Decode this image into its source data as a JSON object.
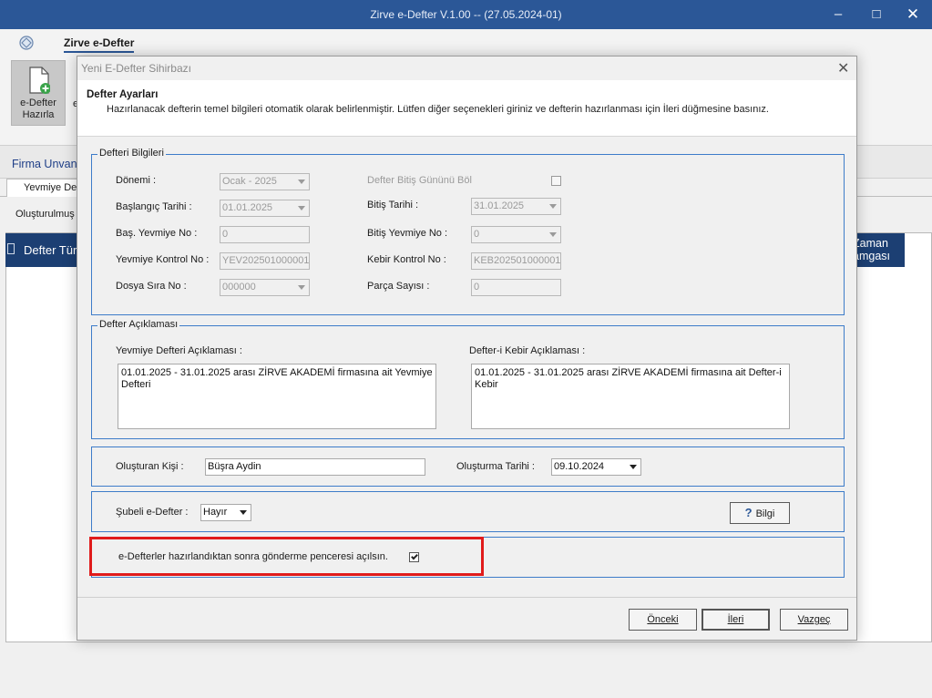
{
  "window": {
    "title": "Zirve e-Defter V.1.00  -- (27.05.2024-01)"
  },
  "ribbon": {
    "tab": "Zirve e-Defter",
    "prepare_button": "e-Defter Hazırla",
    "peek_text": "e",
    "icons": {
      "app": "app-orb-icon",
      "new_doc": "new-document-icon"
    }
  },
  "background": {
    "firma_label": "Firma Unvan",
    "tab_label": "Yevmiye Def",
    "olusturulmus": "Oluşturulmuş E",
    "grid": {
      "col1": "Defter Tür",
      "col2_line1": "Zaman",
      "col2_line2": "amgası"
    }
  },
  "dialog": {
    "title": "Yeni E-Defter Sihirbazı",
    "header_title": "Defter Ayarları",
    "header_desc": "Hazırlanacak defterin temel bilgileri otomatik olarak belirlenmiştir. Lütfen diğer seçenekleri giriniz ve defterin hazırlanması için İleri düğmesine basınız.",
    "bilgileri": {
      "legend": "Defteri Bilgileri",
      "donemi_label": "Dönemi :",
      "donemi_value": "Ocak - 2025",
      "bitis_gunu_label": "Defter Bitiş Gününü Böl",
      "baslangic_label": "Başlangıç Tarihi :",
      "baslangic_value": "01.01.2025",
      "bitis_label": "Bitiş Tarihi :",
      "bitis_value": "31.01.2025",
      "bas_yevmiye_label": "Baş. Yevmiye No :",
      "bas_yevmiye_value": "0",
      "bitis_yevmiye_label": "Bitiş Yevmiye No :",
      "bitis_yevmiye_value": "0",
      "yevmiye_kontrol_label": "Yevmiye Kontrol No :",
      "yevmiye_kontrol_value": "YEV202501000001",
      "kebir_kontrol_label": "Kebir Kontrol No :",
      "kebir_kontrol_value": "KEB202501000001",
      "dosya_sira_label": "Dosya Sıra No :",
      "dosya_sira_value": "000000",
      "parca_label": "Parça Sayısı :",
      "parca_value": "0"
    },
    "aciklama": {
      "legend": "Defter Açıklaması",
      "yevmiye_label": "Yevmiye Defteri Açıklaması :",
      "yevmiye_value": "01.01.2025 - 31.01.2025 arası ZİRVE AKADEMİ firmasına ait Yevmiye Defteri",
      "kebir_label": "Defter-i Kebir Açıklaması :",
      "kebir_value": "01.01.2025 - 31.01.2025 arası ZİRVE AKADEMİ firmasına ait Defter-i Kebir"
    },
    "olusturan": {
      "kisi_label": "Oluşturan Kişi :",
      "kisi_value": "Büşra Aydin",
      "tarih_label": "Oluşturma Tarihi :",
      "tarih_value": "09.10.2024"
    },
    "subeli": {
      "label": "Şubeli e-Defter :",
      "value": "Hayır",
      "help_button": "Bilgi"
    },
    "gonderme": {
      "label": "e-Defterler hazırlandıktan sonra gönderme penceresi açılsın.",
      "checked": true
    },
    "buttons": {
      "prev": "Önceki",
      "next": "İleri",
      "cancel": "Vazgeç"
    }
  }
}
